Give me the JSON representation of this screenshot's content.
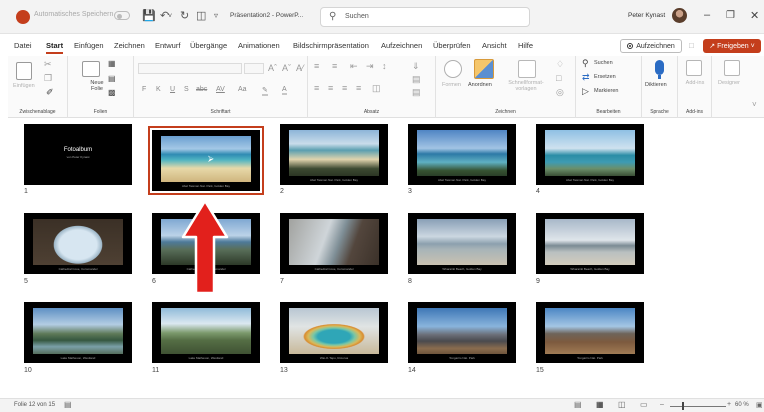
{
  "titlebar": {
    "autosave_label": "Automatisches Speichern",
    "document_title": "Präsentation2 - PowerP...",
    "search_placeholder": "Suchen",
    "user_name": "Peter Kynast",
    "save_icon": "save-icon",
    "undo_icon": "undo-icon",
    "redo_icon": "redo-icon"
  },
  "menu": {
    "tabs": [
      "Datei",
      "Start",
      "Einfügen",
      "Zeichnen",
      "Entwurf",
      "Übergänge",
      "Animationen",
      "Bildschirmpräsentation",
      "Aufzeichnen",
      "Überprüfen",
      "Ansicht",
      "Hilfe"
    ],
    "active_tab": "Start",
    "record_button": "Aufzeichnen",
    "share_button": "Freigeben"
  },
  "ribbon": {
    "clipboard": {
      "paste_label": "Einfügen",
      "group_label": "Zwischenablage"
    },
    "slides": {
      "new_slide_label": "Neue Folie",
      "group_label": "Folien"
    },
    "font": {
      "group_label": "Schriftart",
      "format_buttons": [
        "F",
        "K",
        "U",
        "S",
        "abc",
        "AV",
        "Aa"
      ]
    },
    "paragraph": {
      "group_label": "Absatz"
    },
    "drawing": {
      "shapes_label": "Formen",
      "arrange_label": "Anordnen",
      "quick_styles_label": "Schnellformat-vorlagen",
      "group_label": "Zeichnen"
    },
    "editing": {
      "find_label": "Suchen",
      "replace_label": "Ersetzen",
      "select_label": "Markieren",
      "group_label": "Bearbeiten"
    },
    "voice": {
      "dictate_label": "Diktieren",
      "group_label": "Sprache"
    },
    "addins": {
      "addins_label": "Add-ins",
      "group_label": "Add-ins"
    },
    "designer": {
      "label": "Designer"
    }
  },
  "slides": [
    {
      "num": "1",
      "kind": "title",
      "title": "Fotoalbum",
      "subtitle": "von Peter Kynast",
      "caption": ""
    },
    {
      "num": "",
      "kind": "photo",
      "photo": "beach",
      "caption": "Abel Tasman Nat. Park, Golden Bay",
      "selected": true
    },
    {
      "num": "2",
      "kind": "photo",
      "photo": "beach2",
      "caption": "Abel Tasman Nat. Park, Golden Bay"
    },
    {
      "num": "3",
      "kind": "photo",
      "photo": "sea",
      "caption": "Abel Tasman Nat. Park, Golden Bay"
    },
    {
      "num": "4",
      "kind": "photo",
      "photo": "rock",
      "caption": "Abel Tasman Nat. Park, Golden Bay"
    },
    {
      "num": "5",
      "kind": "photo",
      "photo": "arch",
      "caption": "Cathedral Cove, Coromandel"
    },
    {
      "num": "6",
      "kind": "photo",
      "photo": "coast",
      "caption": "Cathedral Cove, Coromandel"
    },
    {
      "num": "7",
      "kind": "photo",
      "photo": "cliff",
      "caption": "Cathedral Cove, Coromandel"
    },
    {
      "num": "8",
      "kind": "photo",
      "photo": "stacks",
      "caption": "Wharariki Beach, Golden Bay"
    },
    {
      "num": "9",
      "kind": "photo",
      "photo": "stacks2",
      "caption": "Wharariki Beach, Golden Bay"
    },
    {
      "num": "10",
      "kind": "photo",
      "photo": "lake",
      "caption": "Lake Matheson, Westland"
    },
    {
      "num": "11",
      "kind": "photo",
      "photo": "valley",
      "caption": "Lake Matheson, Westland"
    },
    {
      "num": "13",
      "kind": "photo",
      "photo": "pool",
      "caption": "Wai-O-Tapu, Rotorua"
    },
    {
      "num": "14",
      "kind": "photo",
      "photo": "mount",
      "caption": "Tongariro Nat. Park"
    },
    {
      "num": "15",
      "kind": "photo",
      "photo": "volcano",
      "caption": "Tongariro Nat. Park"
    }
  ],
  "annotation": {
    "arrow_color": "#e2201c",
    "arrow_direction": "up"
  },
  "statusbar": {
    "slide_info": "Folie 12 von 15",
    "zoom": "60 %",
    "zoom_percent": 60
  },
  "colors": {
    "accent": "#c43e1c",
    "share": "#c43e1c",
    "selected_outline": "#c43e1c"
  }
}
